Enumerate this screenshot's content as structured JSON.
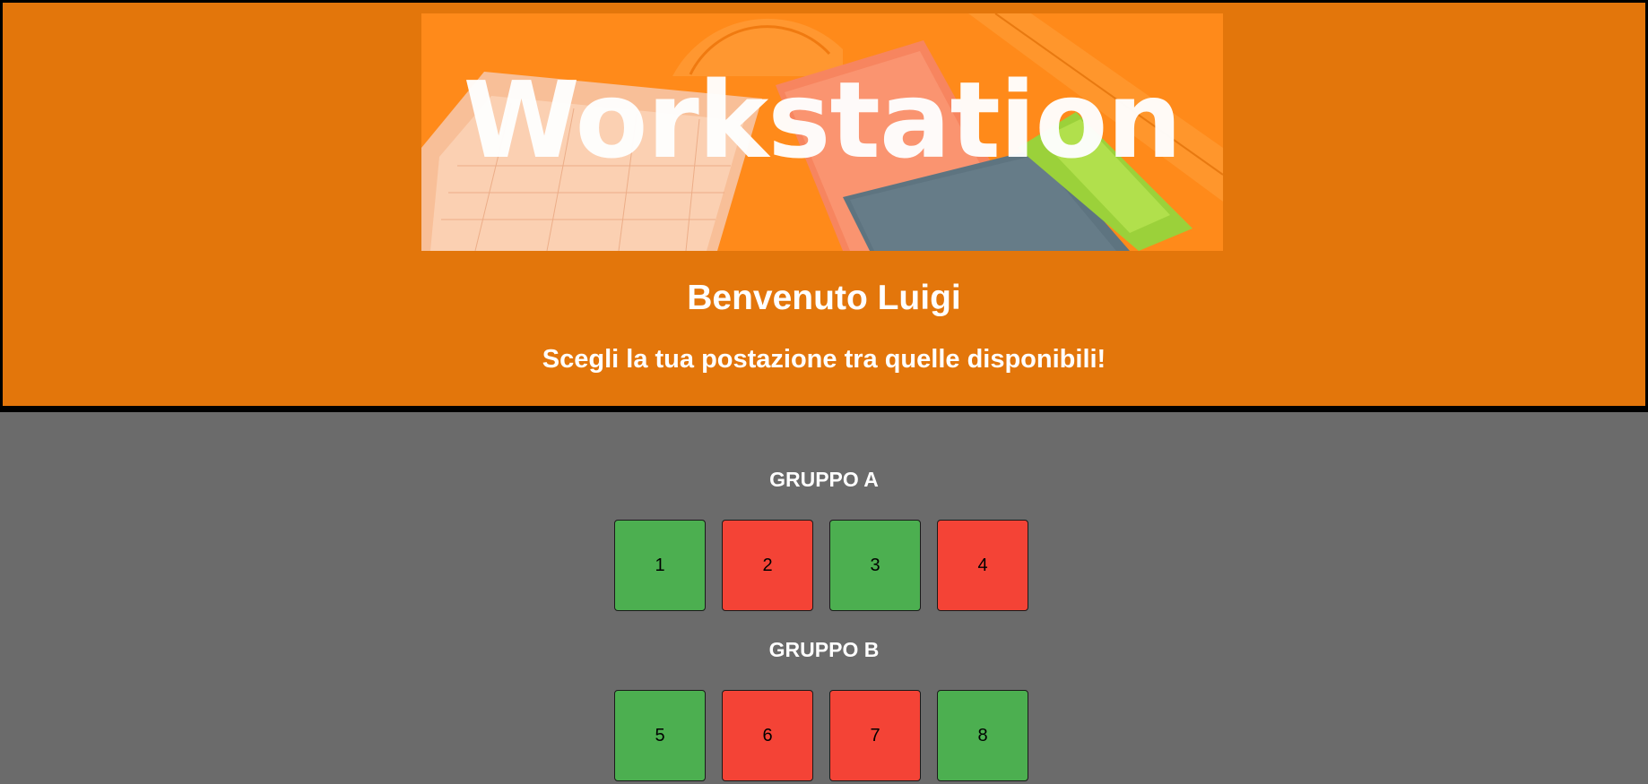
{
  "banner": {
    "title": "Workstation"
  },
  "header": {
    "welcome": "Benvenuto Luigi",
    "subtitle": "Scegli la tua postazione tra quelle disponibili!"
  },
  "groups": [
    {
      "title": "GRUPPO A",
      "seats": [
        {
          "number": "1",
          "status": "available",
          "color": "#4caf50"
        },
        {
          "number": "2",
          "status": "occupied",
          "color": "#f44336"
        },
        {
          "number": "3",
          "status": "available",
          "color": "#4caf50"
        },
        {
          "number": "4",
          "status": "occupied",
          "color": "#f44336"
        }
      ]
    },
    {
      "title": "GRUPPO B",
      "seats": [
        {
          "number": "5",
          "status": "available",
          "color": "#4caf50"
        },
        {
          "number": "6",
          "status": "occupied",
          "color": "#f44336"
        },
        {
          "number": "7",
          "status": "occupied",
          "color": "#f44336"
        },
        {
          "number": "8",
          "status": "available",
          "color": "#4caf50"
        }
      ]
    }
  ],
  "colors": {
    "header_bg": "#e3760b",
    "page_bg": "#6b6b6b",
    "available": "#4caf50",
    "occupied": "#f44336"
  }
}
